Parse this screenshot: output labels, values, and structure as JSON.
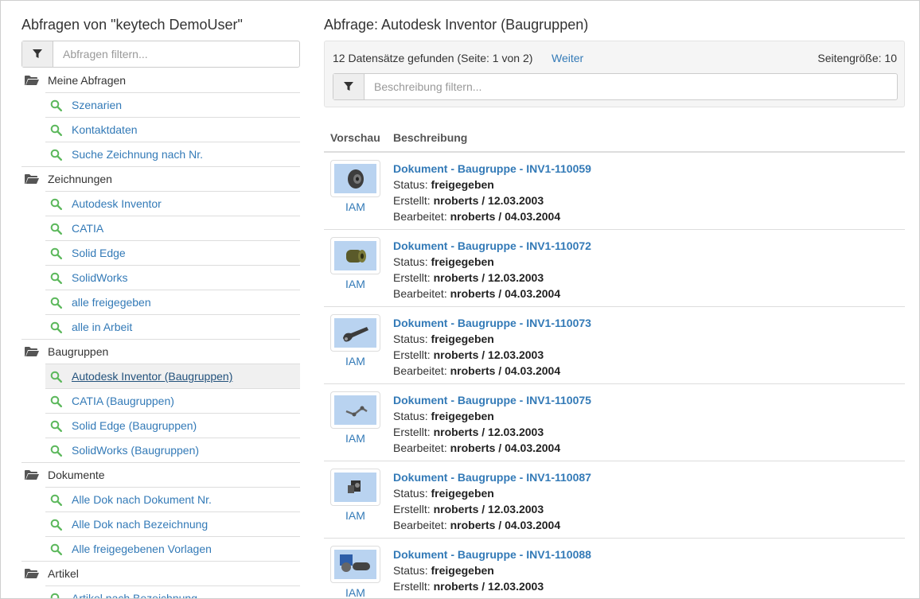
{
  "left": {
    "title": "Abfragen von \"keytech DemoUser\"",
    "filter_placeholder": "Abfragen filtern...",
    "groups": [
      {
        "label": "Meine Abfragen",
        "items": [
          "Szenarien",
          "Kontaktdaten",
          "Suche Zeichnung nach Nr."
        ]
      },
      {
        "label": "Zeichnungen",
        "items": [
          "Autodesk Inventor",
          "CATIA",
          "Solid Edge",
          "SolidWorks",
          "alle freigegeben",
          "alle in Arbeit"
        ]
      },
      {
        "label": "Baugruppen",
        "items": [
          "Autodesk Inventor (Baugruppen)",
          "CATIA (Baugruppen)",
          "Solid Edge (Baugruppen)",
          "SolidWorks (Baugruppen)"
        ]
      },
      {
        "label": "Dokumente",
        "items": [
          "Alle Dok nach Dokument Nr.",
          "Alle Dok nach Bezeichnung",
          "Alle freigegebenen Vorlagen"
        ]
      },
      {
        "label": "Artikel",
        "items": [
          "Artikel nach Bezeichnung"
        ]
      }
    ],
    "selected_item": "Autodesk Inventor (Baugruppen)"
  },
  "right": {
    "title": "Abfrage: Autodesk Inventor (Baugruppen)",
    "result_info": "12 Datensätze gefunden (Seite: 1 von 2)",
    "next_label": "Weiter",
    "page_size_label": "Seitengröße: 10",
    "filter_placeholder": "Beschreibung filtern...",
    "columns": [
      "Vorschau",
      "Beschreibung"
    ],
    "labels": {
      "status": "Status:",
      "created": "Erstellt:",
      "edited": "Bearbeitet:"
    },
    "rows": [
      {
        "title": "Dokument - Baugruppe - INV1-110059",
        "type": "IAM",
        "status": "freigegeben",
        "created": "nroberts / 12.03.2003",
        "edited": "nroberts / 04.03.2004",
        "thumb_icon": "wheel-part-icon"
      },
      {
        "title": "Dokument - Baugruppe - INV1-110072",
        "type": "IAM",
        "status": "freigegeben",
        "created": "nroberts / 12.03.2003",
        "edited": "nroberts / 04.03.2004",
        "thumb_icon": "cylinder-part-icon"
      },
      {
        "title": "Dokument - Baugruppe - INV1-110073",
        "type": "IAM",
        "status": "freigegeben",
        "created": "nroberts / 12.03.2003",
        "edited": "nroberts / 04.03.2004",
        "thumb_icon": "bracket-part-icon"
      },
      {
        "title": "Dokument - Baugruppe - INV1-110075",
        "type": "IAM",
        "status": "freigegeben",
        "created": "nroberts / 12.03.2003",
        "edited": "nroberts / 04.03.2004",
        "thumb_icon": "linkage-part-icon"
      },
      {
        "title": "Dokument - Baugruppe - INV1-110087",
        "type": "IAM",
        "status": "freigegeben",
        "created": "nroberts / 12.03.2003",
        "edited": "nroberts / 04.03.2004",
        "thumb_icon": "clamp-part-icon"
      },
      {
        "title": "Dokument - Baugruppe - INV1-110088",
        "type": "IAM",
        "status": "freigegeben",
        "created": "nroberts / 12.03.2003",
        "edited": "",
        "thumb_icon": "motor-part-icon"
      }
    ]
  },
  "colors": {
    "link": "#337ab7",
    "query_icon": "#5cb85c",
    "folder_icon": "#555555",
    "thumb_bg": "#b9d3f0"
  }
}
